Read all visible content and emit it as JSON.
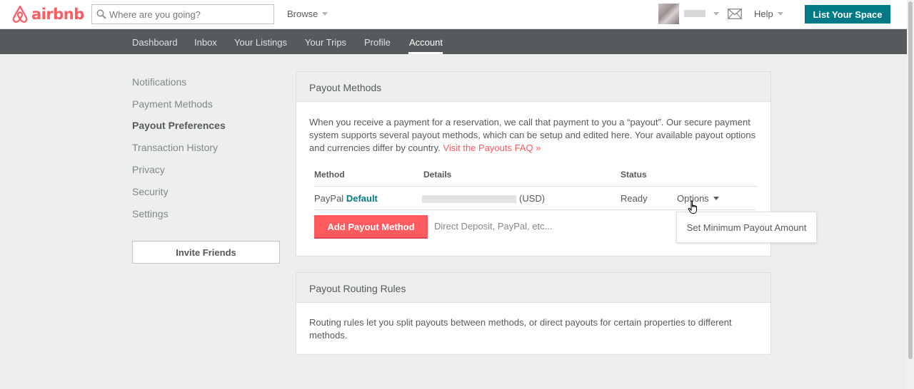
{
  "brand": {
    "name": "airbnb",
    "color": "#ff5a5f"
  },
  "search": {
    "placeholder": "Where are you going?"
  },
  "header": {
    "browse_label": "Browse",
    "help_label": "Help",
    "list_space_label": "List Your Space",
    "accent": "#007a87"
  },
  "subnav": {
    "items": [
      "Dashboard",
      "Inbox",
      "Your Listings",
      "Your Trips",
      "Profile",
      "Account"
    ],
    "active": "Account"
  },
  "sidenav": {
    "items": [
      "Notifications",
      "Payment Methods",
      "Payout Preferences",
      "Transaction History",
      "Privacy",
      "Security",
      "Settings"
    ],
    "active": "Payout Preferences",
    "invite_label": "Invite Friends"
  },
  "payout_methods": {
    "title": "Payout Methods",
    "description": "When you receive a payment for a reservation, we call that payment to you a “payout”. Our secure payment system supports several payout methods, which can be setup and edited here. Your available payout options and currencies differ by country.",
    "faq_link": "Visit the Payouts FAQ »",
    "columns": [
      "Method",
      "Details",
      "Status"
    ],
    "rows": [
      {
        "method": "PayPal",
        "tag": "Default",
        "currency": "(USD)",
        "status": "Ready",
        "options_label": "Options"
      }
    ],
    "add_button_label": "Add Payout Method",
    "add_hint": "Direct Deposit, PayPal, etc..."
  },
  "options_menu": {
    "items": [
      "Set Minimum Payout Amount"
    ]
  },
  "routing_rules": {
    "title": "Payout Routing Rules",
    "description": "Routing rules let you split payouts between methods, or direct payouts for certain properties to different methods."
  }
}
